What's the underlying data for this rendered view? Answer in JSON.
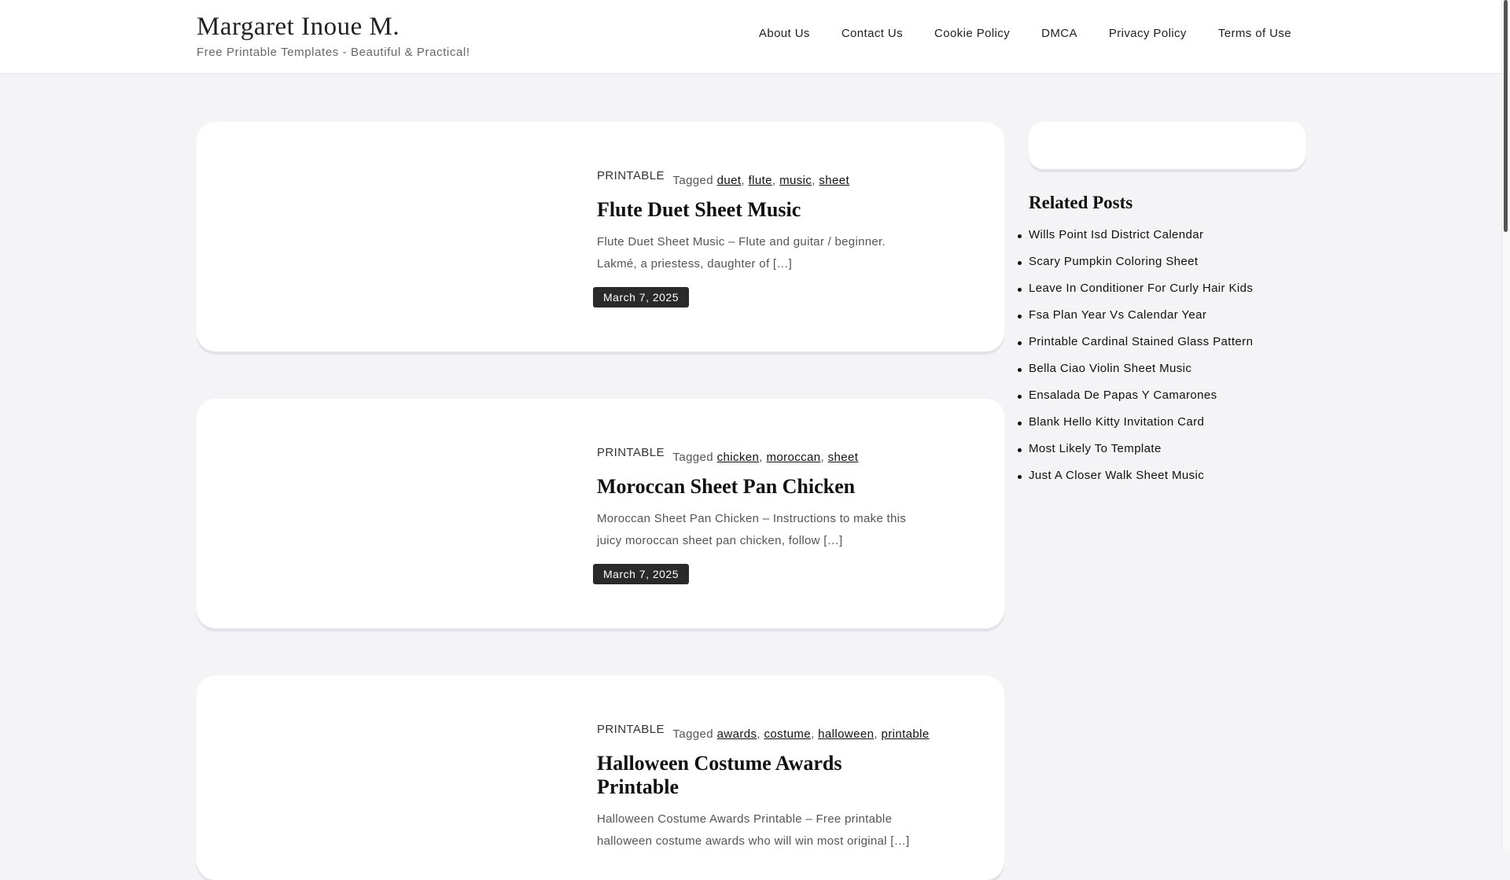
{
  "header": {
    "site_title": "Margaret Inoue M.",
    "tagline": "Free Printable Templates - Beautiful & Practical!",
    "nav": [
      "About Us",
      "Contact Us",
      "Cookie Policy",
      "DMCA",
      "Privacy Policy",
      "Terms of Use"
    ]
  },
  "posts": [
    {
      "category": "PRINTABLE",
      "tagged_label": "Tagged",
      "tags": [
        "duet",
        "flute",
        "music",
        "sheet"
      ],
      "title": "Flute Duet Sheet Music",
      "excerpt": "Flute Duet Sheet Music – Flute and guitar / beginner. Lakmé, a priestess, daughter of […]",
      "date": "March 7, 2025"
    },
    {
      "category": "PRINTABLE",
      "tagged_label": "Tagged",
      "tags": [
        "chicken",
        "moroccan",
        "sheet"
      ],
      "title": "Moroccan Sheet Pan Chicken",
      "excerpt": "Moroccan Sheet Pan Chicken – Instructions to make this juicy moroccan sheet pan chicken, follow […]",
      "date": "March 7, 2025"
    },
    {
      "category": "PRINTABLE",
      "tagged_label": "Tagged",
      "tags": [
        "awards",
        "costume",
        "halloween",
        "printable"
      ],
      "title": "Halloween Costume Awards Printable",
      "excerpt": "Halloween Costume Awards Printable – Free printable halloween costume awards who will win most original […]",
      "date": ""
    }
  ],
  "sidebar": {
    "related_heading": "Related Posts",
    "related_posts": [
      "Wills Point Isd District Calendar",
      "Scary Pumpkin Coloring Sheet",
      "Leave In Conditioner For Curly Hair Kids",
      "Fsa Plan Year Vs Calendar Year",
      "Printable Cardinal Stained Glass Pattern",
      "Bella Ciao Violin Sheet Music",
      "Ensalada De Papas Y Camarones",
      "Blank Hello Kitty Invitation Card",
      "Most Likely To Template",
      "Just A Closer Walk Sheet Music"
    ]
  }
}
